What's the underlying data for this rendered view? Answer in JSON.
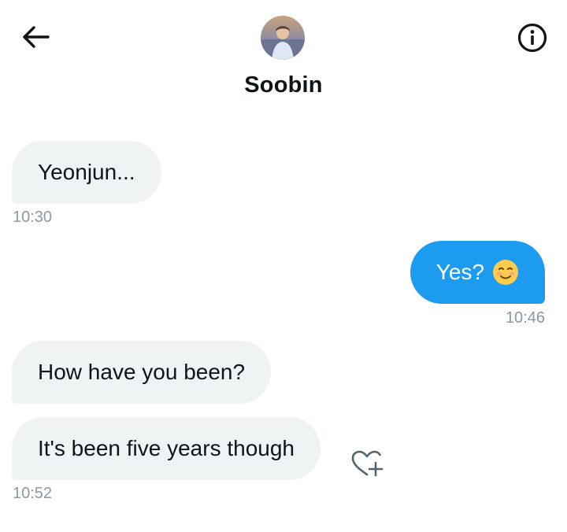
{
  "header": {
    "contact_name": "Soobin",
    "back_icon": "arrow-left-icon",
    "info_icon": "info-circle-icon"
  },
  "messages": [
    {
      "direction": "in",
      "text": "Yeonjun...",
      "timestamp": "10:30"
    },
    {
      "direction": "out",
      "text": "Yes?",
      "emoji": "☺️",
      "timestamp": "10:46"
    },
    {
      "direction": "in",
      "text": "How have you been?"
    },
    {
      "direction": "in",
      "text": "It's been five years though",
      "timestamp": "10:52"
    }
  ],
  "colors": {
    "incoming_bubble": "#eff3f4",
    "outgoing_bubble": "#1d9bf0",
    "timestamp": "#8b98a5",
    "text": "#0f1419"
  },
  "reaction": {
    "icon": "heart-plus-icon"
  }
}
